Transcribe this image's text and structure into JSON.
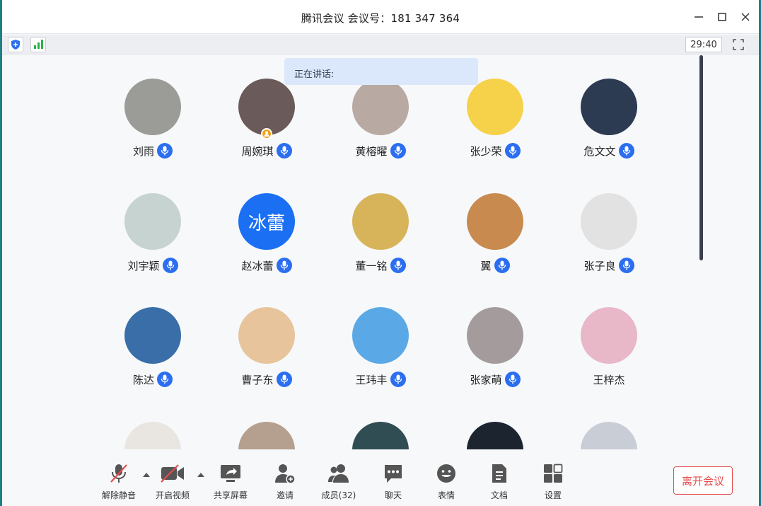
{
  "window": {
    "title": "腾讯会议  会议号：181 347 364"
  },
  "infobar": {
    "timer": "29:40"
  },
  "speaking": {
    "label": "正在讲话:"
  },
  "colors": {
    "accent": "#2b6ef0",
    "leave": "#e54d4d",
    "host_badge": "#f2a21a",
    "signal": "#2bb14a"
  },
  "participants": [
    {
      "name": "刘雨",
      "mic": true,
      "bg": "#9b9b97"
    },
    {
      "name": "周婉琪",
      "mic": true,
      "bg": "#6b5a5a",
      "host": true
    },
    {
      "name": "黄榕曜",
      "mic": true,
      "bg": "#b8a9a2"
    },
    {
      "name": "张少荣",
      "mic": true,
      "bg": "#f6d14a"
    },
    {
      "name": "危文文",
      "mic": true,
      "bg": "#2c3a52"
    },
    {
      "name": "刘宇颖",
      "mic": true,
      "bg": "#c7d3d1"
    },
    {
      "name": "赵冰蕾",
      "mic": true,
      "bg": "#1a6ff2",
      "text": "冰蕾"
    },
    {
      "name": "董一铭",
      "mic": true,
      "bg": "#d7b45a"
    },
    {
      "name": "翼",
      "mic": true,
      "bg": "#c88a4f"
    },
    {
      "name": "张子良",
      "mic": true,
      "bg": "#e2e2e2"
    },
    {
      "name": "陈达",
      "mic": true,
      "bg": "#3a6ea8"
    },
    {
      "name": "曹子东",
      "mic": true,
      "bg": "#e7c49b"
    },
    {
      "name": "王玮丰",
      "mic": true,
      "bg": "#5aa9e6"
    },
    {
      "name": "张家萌",
      "mic": true,
      "bg": "#a49c9c"
    },
    {
      "name": "王梓杰",
      "mic": false,
      "bg": "#e8b7c8"
    },
    {
      "name": "",
      "mic": false,
      "bg": "#e9e6e1"
    },
    {
      "name": "",
      "mic": false,
      "bg": "#b59f8e"
    },
    {
      "name": "",
      "mic": false,
      "bg": "#2f4d52"
    },
    {
      "name": "",
      "mic": false,
      "bg": "#1c2430"
    },
    {
      "name": "",
      "mic": false,
      "bg": "#c9ced6"
    }
  ],
  "toolbar": {
    "unmute": "解除静音",
    "video": "开启视频",
    "share": "共享屏幕",
    "invite": "邀请",
    "members": "成员(32)",
    "chat": "聊天",
    "emoji": "表情",
    "docs": "文档",
    "settings": "设置",
    "leave": "离开会议"
  }
}
